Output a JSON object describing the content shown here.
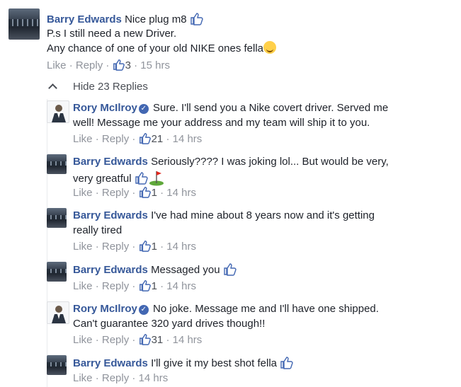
{
  "top_comment": {
    "author": "Barry Edwards",
    "line1": "Nice plug m8",
    "line2": "P.s I still need a new Driver.",
    "line3": "Any chance of one of your old NIKE ones fella",
    "like": "Like",
    "reply": "Reply",
    "reactions": "3",
    "time": "15 hrs"
  },
  "hide_replies": "Hide 23 Replies",
  "separator": "·",
  "replies": [
    {
      "author": "Rory McIlroy",
      "line1": "Sure. I'll send you a Nike covert driver. Served me",
      "line2": "well! Message me your address and my team will ship it to you.",
      "like": "Like",
      "reply": "Reply",
      "reactions": "21",
      "time": "14 hrs"
    },
    {
      "author": "Barry Edwards",
      "line1": "Seriously???? I was joking lol... But would be very,",
      "line2": "very greatful",
      "like": "Like",
      "reply": "Reply",
      "reactions": "1",
      "time": "14 hrs"
    },
    {
      "author": "Barry Edwards",
      "line1": "I've had mine about 8 years now and it's getting",
      "line2": "really tired",
      "like": "Like",
      "reply": "Reply",
      "reactions": "1",
      "time": "14 hrs"
    },
    {
      "author": "Barry Edwards",
      "line1": "Messaged you",
      "like": "Like",
      "reply": "Reply",
      "reactions": "1",
      "time": "14 hrs"
    },
    {
      "author": "Rory McIlroy",
      "line1": "No joke. Message me and I'll have one shipped.",
      "line2": "Can't guarantee 320 yard drives though!!",
      "like": "Like",
      "reply": "Reply",
      "reactions": "31",
      "time": "14 hrs"
    },
    {
      "author": "Barry Edwards",
      "line1": "I'll give it my best shot fella",
      "like": "Like",
      "reply": "Reply",
      "time": "14 hrs"
    }
  ],
  "colors": {
    "name": "#365899",
    "meta": "#90949c",
    "text": "#1d2129",
    "accent": "#4267b2"
  },
  "icons": {
    "thumb": "thumbs-up-outline-icon",
    "reaction": "like-reaction-icon",
    "verified": "verified-badge-icon",
    "chevron": "chevron-up-icon",
    "emoji": "tongue-wink-emoji-icon",
    "golf": "golf-flag-emoji-icon"
  }
}
